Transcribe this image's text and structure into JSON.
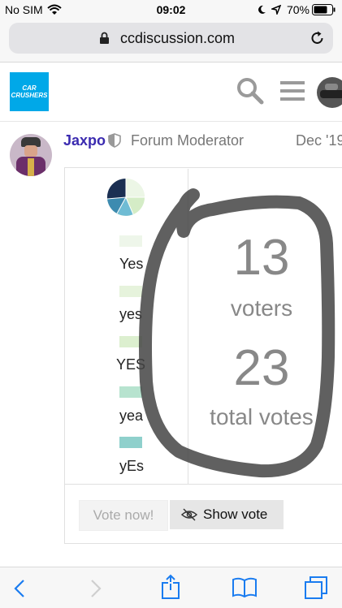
{
  "status_bar": {
    "carrier": "No SIM",
    "time": "09:02",
    "battery": "70%"
  },
  "browser": {
    "url": "ccdiscussion.com"
  },
  "site": {
    "logo_line1": "CAR",
    "logo_line2": "CRUSHERS"
  },
  "post": {
    "username": "Jaxpo",
    "role": "Forum Moderator",
    "date": "Dec '19"
  },
  "poll": {
    "options": [
      {
        "label": "Yes",
        "color": "#eef6ea",
        "bar": 0.2
      },
      {
        "label": "yes",
        "color": "#e6f3dc",
        "bar": 0.2
      },
      {
        "label": "YES",
        "color": "#dcefcf",
        "bar": 0.2
      },
      {
        "label": "yea",
        "color": "#b7e3cf",
        "bar": 0.2
      },
      {
        "label": "yEs",
        "color": "#8fd0cc",
        "bar": 0.2
      }
    ],
    "voters": "13",
    "voters_label": "voters",
    "total_votes": "23",
    "total_votes_label": "total votes",
    "vote_now_label": "Vote now!",
    "show_vote_label": "Show vote"
  },
  "colors": {
    "username": "#3b2bb0",
    "ios_blue": "#1a7cf0",
    "logo_bg": "#00a8e8"
  }
}
